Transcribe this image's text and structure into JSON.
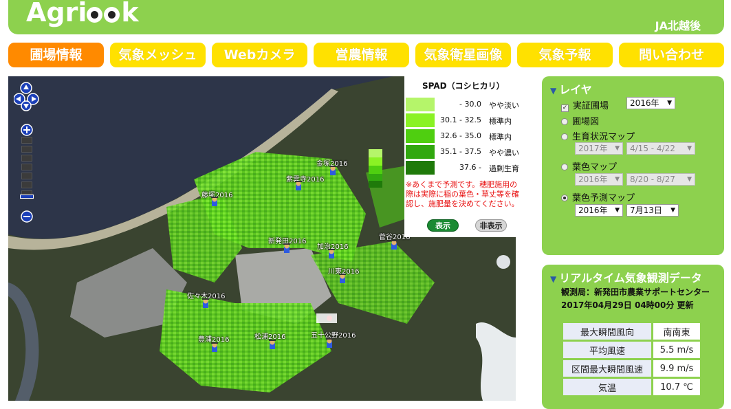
{
  "header": {
    "logo_text_left": "Agri",
    "logo_text_right": "k",
    "organization": "JA北越後",
    "brand_color": "#8dd14e"
  },
  "nav": {
    "items": [
      {
        "label": "圃場情報",
        "active": true
      },
      {
        "label": "気象メッシュ",
        "active": false
      },
      {
        "label": "Webカメラ",
        "active": false
      },
      {
        "label": "営農情報",
        "active": false
      },
      {
        "label": "気象衛星画像",
        "active": false
      },
      {
        "label": "気象予報",
        "active": false
      },
      {
        "label": "問い合わせ",
        "active": false
      }
    ]
  },
  "map": {
    "markers": [
      {
        "label": "金塚2016"
      },
      {
        "label": "紫雲寺2016"
      },
      {
        "label": "藤塚2016"
      },
      {
        "label": "新発田2016"
      },
      {
        "label": "加治2016"
      },
      {
        "label": "菅谷2016"
      },
      {
        "label": "川東2016"
      },
      {
        "label": "佐々木2016"
      },
      {
        "label": "豊浦2016"
      },
      {
        "label": "松浦2016"
      },
      {
        "label": "五十公野2016"
      }
    ]
  },
  "legend": {
    "title": "SPAD（コシヒカリ）",
    "rows": [
      {
        "range": "- 30.0",
        "desc": "やや淡い",
        "color": "#b5f56a"
      },
      {
        "range": "30.1 - 32.5",
        "desc": "標準内",
        "color": "#8af224"
      },
      {
        "range": "32.6 - 35.0",
        "desc": "標準内",
        "color": "#4fcf10"
      },
      {
        "range": "35.1 - 37.5",
        "desc": "やや濃い",
        "color": "#31a80f"
      },
      {
        "range": "37.6 -",
        "desc": "過剰生育",
        "color": "#1f7a0a"
      }
    ],
    "note": "※あくまで予測です。穂肥施用の際は実際に稲の葉色・草丈等を確認し、施肥量を決めてください。",
    "show_label": "表示",
    "hide_label": "非表示"
  },
  "layers": {
    "title": "レイヤ",
    "items": {
      "field_trial": {
        "label": "実証圃場",
        "checked": true,
        "year": "2016年"
      },
      "field_map": {
        "label": "圃場図"
      },
      "growth_map": {
        "label": "生育状況マップ",
        "year": "2017年",
        "period": "4/15 - 4/22"
      },
      "leaf_map": {
        "label": "葉色マップ",
        "year": "2016年",
        "period": "8/20 - 8/27"
      },
      "leaf_forecast": {
        "label": "葉色予測マップ",
        "selected": true,
        "year": "2016年",
        "date": "7月13日"
      }
    }
  },
  "weather": {
    "title": "リアルタイム気象観測データ",
    "station": "観測局：新発田市農業サポートセンター",
    "updated": "2017年04月29日 04時00分 更新",
    "rows": [
      {
        "key": "最大瞬間風向",
        "value": "南南東"
      },
      {
        "key": "平均風速",
        "value": "5.5 m/s"
      },
      {
        "key": "区間最大瞬間風速",
        "value": "9.9 m/s"
      },
      {
        "key": "気温",
        "value": "10.7 ℃"
      }
    ]
  }
}
